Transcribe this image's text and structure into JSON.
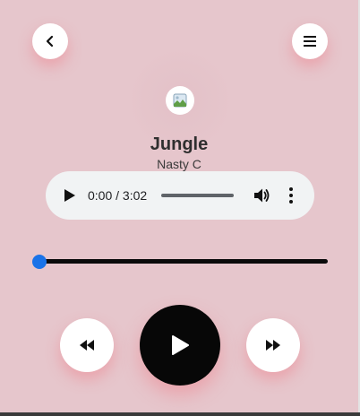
{
  "header": {
    "back_icon": "chevron-left-icon",
    "menu_icon": "hamburger-menu-icon"
  },
  "track": {
    "cover_icon": "broken-image-icon",
    "title": "Jungle",
    "artist": "Nasty C"
  },
  "audio_element": {
    "time_display": "0:00 / 3:02",
    "progress": 0
  },
  "seek_slider": {
    "value_fraction": 0,
    "thumb_color": "#1a73e8"
  },
  "controls": {
    "rewind_icon": "rewind-icon",
    "play_icon": "play-icon",
    "forward_icon": "fast-forward-icon"
  },
  "colors": {
    "background": "#e6c6cc",
    "play_button": "#070707",
    "button_shadow": "#f07882"
  }
}
